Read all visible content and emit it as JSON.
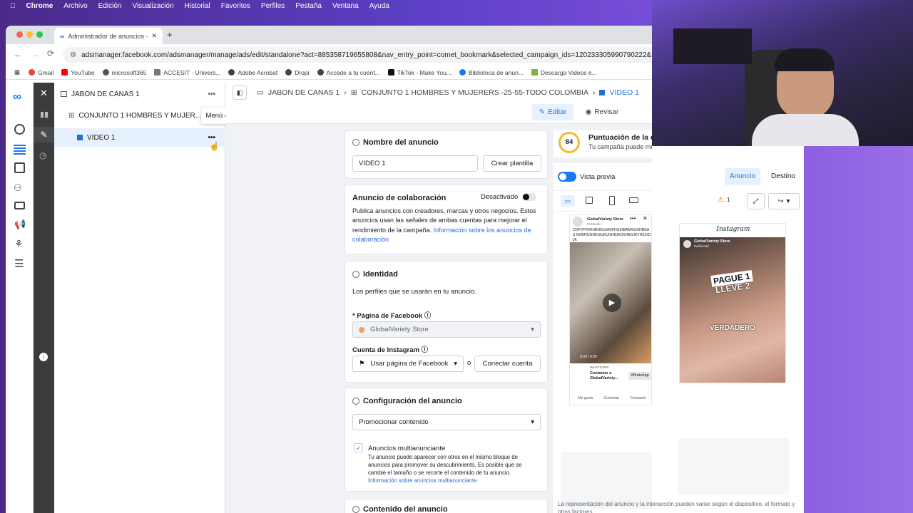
{
  "menubar": {
    "items": [
      "Chrome",
      "Archivo",
      "Edición",
      "Visualización",
      "Historial",
      "Favoritos",
      "Perfiles",
      "Pestaña",
      "Ventana",
      "Ayuda"
    ]
  },
  "browser": {
    "tab_title": "Administrador de anuncios -",
    "url": "adsmanager.facebook.com/adsmanager/manage/ads/edit/standalone?act=885358719655808&nav_entry_point=comet_bookmark&selected_campaign_ids=120233305990790222&",
    "bookmarks": [
      "Gmail",
      "YouTube",
      "microsoft365",
      "ACCESIT - Univers...",
      "Adobe Acrobat",
      "Dropi",
      "Accede a tu cuent...",
      "TikTok - Make You...",
      "Biblioteca de anun...",
      "Descarga Videos e..."
    ]
  },
  "tree": {
    "campaign": "JABON DE CANAS 1",
    "adset": "CONJUNTO 1 HOMBRES Y MUJER...",
    "ad": "VIDEO 1",
    "tooltip": "Menú de acciones"
  },
  "breadcrumb": {
    "campaign": "JABON DE CANAS 1",
    "adset": "CONJUNTO 1 HOMBRES Y MUJERERS -25-55-TODO COLOMBIA",
    "ad": "VIDEO 1"
  },
  "modes": {
    "edit": "Editar",
    "review": "Revisar"
  },
  "score": {
    "value": "84",
    "title": "Puntuación de la c",
    "subtitle": "Tu campaña puede mejorar."
  },
  "ad_name": {
    "title": "Nombre del anuncio",
    "value": "VIDEO 1",
    "template_button": "Crear plantilla"
  },
  "collab": {
    "title": "Anuncio de colaboración",
    "status": "Desactivado",
    "desc": "Publica anuncios con creadores, marcas y otros negocios. Estos anuncios usan las señales de ambas cuentas para mejorar el rendimiento de la campaña.",
    "link": "Información sobre los anuncios de colaboración"
  },
  "identity": {
    "title": "Identidad",
    "desc": "Los perfiles que se usarán en tu anuncio.",
    "fb_label": "* Página de Facebook",
    "fb_value": "GlobalVariety Store",
    "ig_label": "Cuenta de Instagram",
    "ig_value": "Usar página de Facebook",
    "or": "o",
    "connect": "Conectar cuenta"
  },
  "config": {
    "title": "Configuración del anuncio",
    "select": "Promocionar contenido",
    "multi_title": "Anuncios multianunciante",
    "multi_desc": "Tu anuncio puede aparecer con otros en el mismo bloque de anuncios para promover su descubrimiento. Es posible que se cambie el tamaño o se recorte el contenido de tu anuncio.",
    "multi_link": "Información sobre anuncios multianunciante"
  },
  "content": {
    "title": "Contenido del anuncio"
  },
  "preview": {
    "toggle_label": "Vista previa",
    "tab_ad": "Anuncio",
    "tab_dest": "Destino",
    "warn_count": "1",
    "fb": {
      "page": "GlobalVariety Store",
      "published": "Publicado",
      "text": "COPYFFDHUBHGUJADFHGIHBAERIUGHBGAS GHBFIUGHDSIUKUGHBJKDSHBGJKVHIUXDJK",
      "time": "0:00 / 0:30",
      "cta_top": "WHATSAPP",
      "cta_name": "Contactar a GlobalVariety...",
      "cta_btn": "WhatsApp",
      "like": "Me gusta",
      "comment": "Comentar",
      "share": "Compartir"
    },
    "ig": {
      "brand": "Instagram",
      "page": "GlobalVariety Store",
      "published": "Publicidad",
      "headline1": "PAGUE 1",
      "headline2": "LLEVE 2",
      "caption": "VERDADERO"
    },
    "footer": "La representación del anuncio y la interacción pueden variar según el dispositivo, el formato y otros factores."
  },
  "colors": {
    "accent": "#1877f2",
    "score": "#f7b928"
  }
}
